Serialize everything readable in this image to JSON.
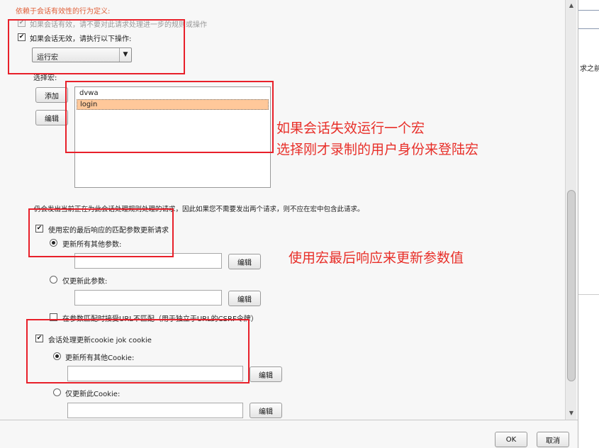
{
  "dialog": {
    "heading": "依赖于会话有效性的行为定义:",
    "valid_label": "如果会话有效，请不要对此请求处理进一步的规则或操作",
    "invalid_label": "如果会话无效，请执行以下操作:",
    "action_select": {
      "selected": "运行宏"
    },
    "macro_label": "选择宏:",
    "add_button": "添加",
    "edit_button": "编辑",
    "macros": [
      "dvwa",
      "login"
    ],
    "note": "仍会发出当前正在为此会话处理规则处理的请求，因此如果您不需要发出两个请求，则不应在宏中包含此请求。",
    "update_params_label": "使用宏的最后响应的匹配参数更新请求",
    "update_all_params_label": "更新所有其他参数:",
    "update_only_params_label": "仅更新此参数:",
    "url_mismatch_label": "在参数匹配时接受URL不匹配（用于独立于URL的CSRF令牌）",
    "cookie_label": "会话处理更新cookie jok cookie",
    "update_all_cookies_label": "更新所有其他Cookie:",
    "update_only_cookies_label": "仅更新此Cookie:",
    "param_edit_button": "编辑",
    "ok_button": "OK",
    "cancel_button": "取消"
  },
  "annotations": {
    "macro_line1": "如果会话失效运行一个宏",
    "macro_line2": "选择刚才录制的用户身份来登陆宏",
    "params_note": "使用宏最后响应来更新参数值"
  },
  "background_window": {
    "fragment": "求之前"
  },
  "colors": {
    "annotation": "#e8202a",
    "heading": "#e0603a",
    "selected_row": "#ffc89a"
  }
}
